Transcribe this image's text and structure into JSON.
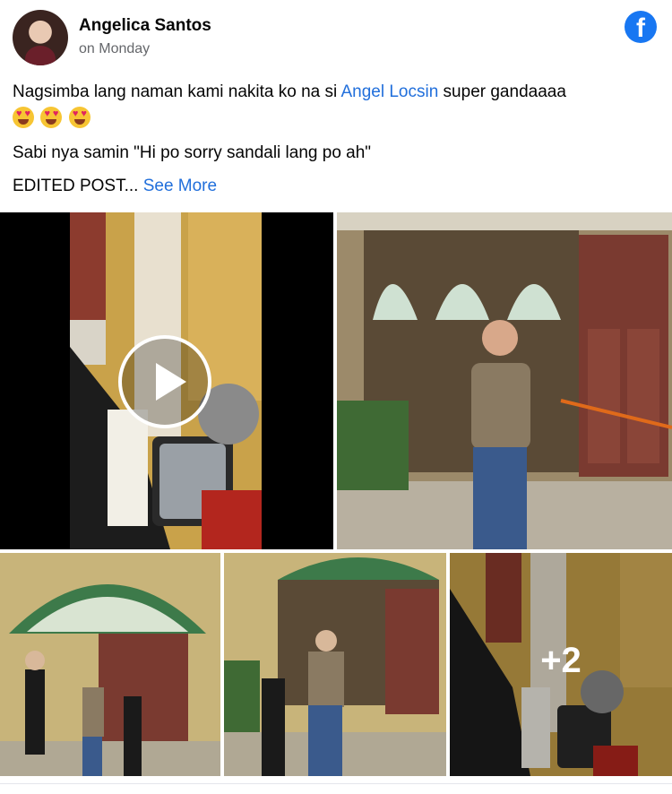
{
  "post": {
    "author": "Angelica Santos",
    "time": "on Monday",
    "text_line1_before": "Nagsimba lang naman kami nakita ko na si ",
    "mention": "Angel Locsin",
    "text_line1_after": " super gandaaaa",
    "emoji": [
      "heart-eyes-emoji",
      "heart-eyes-emoji",
      "heart-eyes-emoji"
    ],
    "text_line2": "Sabi nya samin \"Hi po sorry sandali lang po ah\"",
    "text_line3": "EDITED POST...",
    "see_more": "See More"
  },
  "header": {
    "logo_letter": "f",
    "logo_color": "#1877f2"
  },
  "gallery": {
    "extra_count": "+2",
    "tile_count": 5,
    "has_video": true
  },
  "colors": {
    "link": "#216fdb",
    "secondary_text": "#65676b"
  }
}
